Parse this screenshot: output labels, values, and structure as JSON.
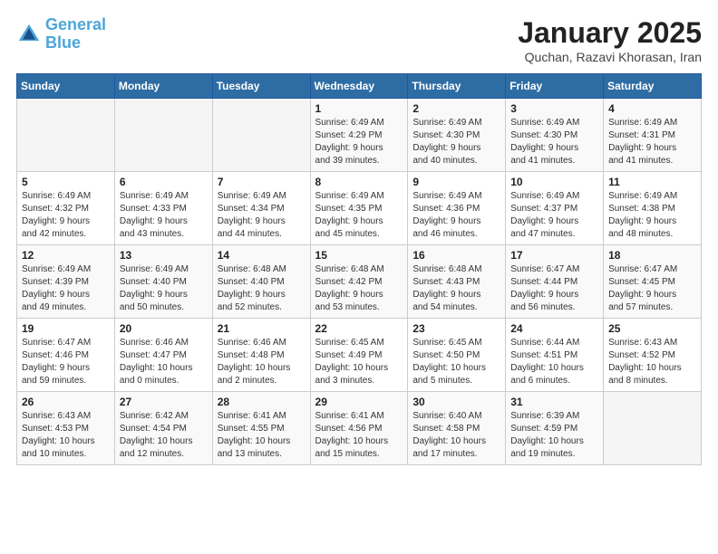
{
  "header": {
    "logo_general": "General",
    "logo_blue": "Blue",
    "month_title": "January 2025",
    "location": "Quchan, Razavi Khorasan, Iran"
  },
  "weekdays": [
    "Sunday",
    "Monday",
    "Tuesday",
    "Wednesday",
    "Thursday",
    "Friday",
    "Saturday"
  ],
  "weeks": [
    [
      {
        "day": "",
        "detail": ""
      },
      {
        "day": "",
        "detail": ""
      },
      {
        "day": "",
        "detail": ""
      },
      {
        "day": "1",
        "detail": "Sunrise: 6:49 AM\nSunset: 4:29 PM\nDaylight: 9 hours\nand 39 minutes."
      },
      {
        "day": "2",
        "detail": "Sunrise: 6:49 AM\nSunset: 4:30 PM\nDaylight: 9 hours\nand 40 minutes."
      },
      {
        "day": "3",
        "detail": "Sunrise: 6:49 AM\nSunset: 4:30 PM\nDaylight: 9 hours\nand 41 minutes."
      },
      {
        "day": "4",
        "detail": "Sunrise: 6:49 AM\nSunset: 4:31 PM\nDaylight: 9 hours\nand 41 minutes."
      }
    ],
    [
      {
        "day": "5",
        "detail": "Sunrise: 6:49 AM\nSunset: 4:32 PM\nDaylight: 9 hours\nand 42 minutes."
      },
      {
        "day": "6",
        "detail": "Sunrise: 6:49 AM\nSunset: 4:33 PM\nDaylight: 9 hours\nand 43 minutes."
      },
      {
        "day": "7",
        "detail": "Sunrise: 6:49 AM\nSunset: 4:34 PM\nDaylight: 9 hours\nand 44 minutes."
      },
      {
        "day": "8",
        "detail": "Sunrise: 6:49 AM\nSunset: 4:35 PM\nDaylight: 9 hours\nand 45 minutes."
      },
      {
        "day": "9",
        "detail": "Sunrise: 6:49 AM\nSunset: 4:36 PM\nDaylight: 9 hours\nand 46 minutes."
      },
      {
        "day": "10",
        "detail": "Sunrise: 6:49 AM\nSunset: 4:37 PM\nDaylight: 9 hours\nand 47 minutes."
      },
      {
        "day": "11",
        "detail": "Sunrise: 6:49 AM\nSunset: 4:38 PM\nDaylight: 9 hours\nand 48 minutes."
      }
    ],
    [
      {
        "day": "12",
        "detail": "Sunrise: 6:49 AM\nSunset: 4:39 PM\nDaylight: 9 hours\nand 49 minutes."
      },
      {
        "day": "13",
        "detail": "Sunrise: 6:49 AM\nSunset: 4:40 PM\nDaylight: 9 hours\nand 50 minutes."
      },
      {
        "day": "14",
        "detail": "Sunrise: 6:48 AM\nSunset: 4:40 PM\nDaylight: 9 hours\nand 52 minutes."
      },
      {
        "day": "15",
        "detail": "Sunrise: 6:48 AM\nSunset: 4:42 PM\nDaylight: 9 hours\nand 53 minutes."
      },
      {
        "day": "16",
        "detail": "Sunrise: 6:48 AM\nSunset: 4:43 PM\nDaylight: 9 hours\nand 54 minutes."
      },
      {
        "day": "17",
        "detail": "Sunrise: 6:47 AM\nSunset: 4:44 PM\nDaylight: 9 hours\nand 56 minutes."
      },
      {
        "day": "18",
        "detail": "Sunrise: 6:47 AM\nSunset: 4:45 PM\nDaylight: 9 hours\nand 57 minutes."
      }
    ],
    [
      {
        "day": "19",
        "detail": "Sunrise: 6:47 AM\nSunset: 4:46 PM\nDaylight: 9 hours\nand 59 minutes."
      },
      {
        "day": "20",
        "detail": "Sunrise: 6:46 AM\nSunset: 4:47 PM\nDaylight: 10 hours\nand 0 minutes."
      },
      {
        "day": "21",
        "detail": "Sunrise: 6:46 AM\nSunset: 4:48 PM\nDaylight: 10 hours\nand 2 minutes."
      },
      {
        "day": "22",
        "detail": "Sunrise: 6:45 AM\nSunset: 4:49 PM\nDaylight: 10 hours\nand 3 minutes."
      },
      {
        "day": "23",
        "detail": "Sunrise: 6:45 AM\nSunset: 4:50 PM\nDaylight: 10 hours\nand 5 minutes."
      },
      {
        "day": "24",
        "detail": "Sunrise: 6:44 AM\nSunset: 4:51 PM\nDaylight: 10 hours\nand 6 minutes."
      },
      {
        "day": "25",
        "detail": "Sunrise: 6:43 AM\nSunset: 4:52 PM\nDaylight: 10 hours\nand 8 minutes."
      }
    ],
    [
      {
        "day": "26",
        "detail": "Sunrise: 6:43 AM\nSunset: 4:53 PM\nDaylight: 10 hours\nand 10 minutes."
      },
      {
        "day": "27",
        "detail": "Sunrise: 6:42 AM\nSunset: 4:54 PM\nDaylight: 10 hours\nand 12 minutes."
      },
      {
        "day": "28",
        "detail": "Sunrise: 6:41 AM\nSunset: 4:55 PM\nDaylight: 10 hours\nand 13 minutes."
      },
      {
        "day": "29",
        "detail": "Sunrise: 6:41 AM\nSunset: 4:56 PM\nDaylight: 10 hours\nand 15 minutes."
      },
      {
        "day": "30",
        "detail": "Sunrise: 6:40 AM\nSunset: 4:58 PM\nDaylight: 10 hours\nand 17 minutes."
      },
      {
        "day": "31",
        "detail": "Sunrise: 6:39 AM\nSunset: 4:59 PM\nDaylight: 10 hours\nand 19 minutes."
      },
      {
        "day": "",
        "detail": ""
      }
    ]
  ]
}
